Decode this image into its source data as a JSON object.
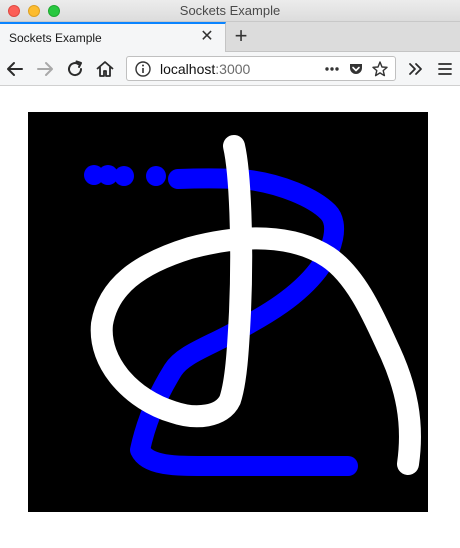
{
  "window": {
    "title": "Sockets Example"
  },
  "tabs": [
    {
      "label": "Sockets Example",
      "active": true
    }
  ],
  "toolbar": {
    "close_tab_glyph": "✕",
    "new_tab_glyph": "+",
    "icons": [
      "back-icon",
      "forward-icon",
      "reload-icon",
      "home-icon",
      "overflow-menu-icon",
      "hamburger-menu-icon"
    ]
  },
  "urlbar": {
    "host": "localhost",
    "port": ":3000",
    "icons": [
      "info-icon",
      "page-actions-icon",
      "pocket-icon",
      "bookmark-star-icon"
    ]
  },
  "drawing_canvas": {
    "background": "#000000",
    "colors": {
      "blue": "#0000ff",
      "white": "#ffffff"
    },
    "strokes": [
      "blue-stroke",
      "white-stroke"
    ]
  }
}
